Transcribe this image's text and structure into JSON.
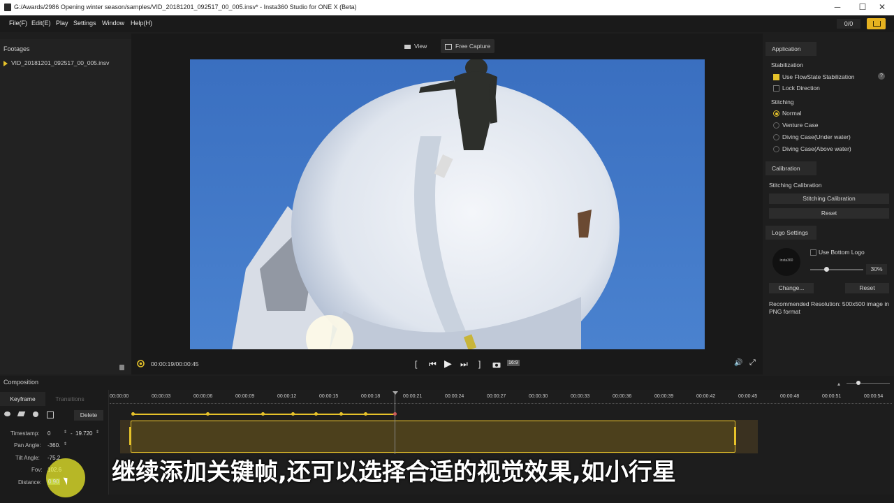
{
  "window": {
    "title": "G:/Awards/2986 Opening winter season/samples/VID_20181201_092517_00_005.insv* - Insta360 Studio for ONE X (Beta)",
    "minimize": "─",
    "maximize": "☐",
    "close": "✕"
  },
  "menu": [
    "File(F)",
    "Edit(E)",
    "Play",
    "Settings",
    "Window",
    "Help(H)"
  ],
  "toolbar": {
    "counter": "0/0"
  },
  "footages": {
    "title": "Footages",
    "items": [
      "VID_20181201_092517_00_005.insv"
    ]
  },
  "viewer": {
    "view_label": "View",
    "free_capture_label": "Free Capture",
    "time": "00:00:19/00:00:45",
    "ratio_badge": "16:9"
  },
  "application": {
    "header": "Application",
    "stabilization_title": "Stabilization",
    "flowstate_label": "Use FlowState Stabilization",
    "flowstate_checked": true,
    "lock_direction_label": "Lock Direction",
    "lock_direction_checked": false,
    "stitching_title": "Stitching",
    "stitching_options": [
      "Normal",
      "Venture Case",
      "Diving Case(Under water)",
      "Diving Case(Above water)"
    ],
    "stitching_selected": "Normal"
  },
  "calibration": {
    "header": "Calibration",
    "subtitle": "Stitching Calibration",
    "calibrate_button": "Stitching Calibration",
    "reset_button": "Reset"
  },
  "logo": {
    "header": "Logo Settings",
    "preview_text": "insta360",
    "use_bottom_logo_label": "Use Bottom Logo",
    "use_bottom_logo_checked": false,
    "size_value": "30%",
    "change_button": "Change...",
    "reset_button": "Reset",
    "recommendation": "Recommended Resolution: 500x500 image in PNG format"
  },
  "composition": {
    "title": "Composition",
    "tabs": [
      "Keyframe",
      "Transitions"
    ],
    "delete_button": "Delete",
    "timestamp_label": "Timestamp:",
    "timestamp_start": "0",
    "timestamp_sep": "-",
    "timestamp_end": "19.720",
    "pan_label": "Pan Angle:",
    "pan_value": "-360.",
    "tilt_label": "Tilt Angle:",
    "tilt_value": "-75.2",
    "fov_label": "Fov:",
    "fov_value": "102.6",
    "distance_label": "Distance:",
    "distance_value": "0.90",
    "ruler": [
      "00:00:00",
      "00:00:03",
      "00:00:06",
      "00:00:09",
      "00:00:12",
      "00:00:15",
      "00:00:18",
      "00:00:21",
      "00:00:24",
      "00:00:27",
      "00:00:30",
      "00:00:33",
      "00:00:36",
      "00:00:39",
      "00:00:42",
      "00:00:45",
      "00:00:48",
      "00:00:51",
      "00:00:54"
    ],
    "playhead_position_s": 19.72
  },
  "subtitle": "继续添加关键帧,还可以选择合适的视觉效果,如小行星",
  "colors": {
    "accent": "#e6c22a",
    "export": "#e6b220",
    "playhead": "#e05050"
  }
}
